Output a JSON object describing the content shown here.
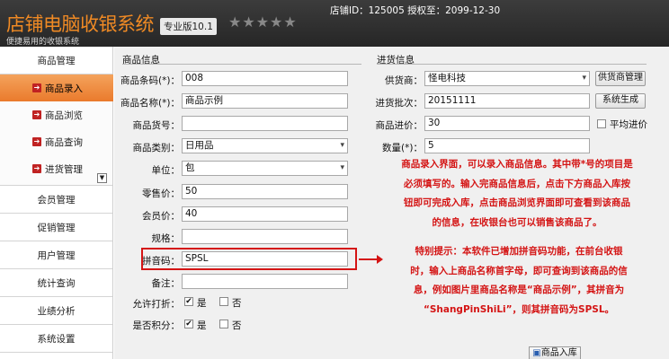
{
  "header": {
    "title": "店铺电脑收银系统",
    "subtitle": "便捷易用的收银系统",
    "edition": "专业版10.1",
    "stars": "★★★★★",
    "shop_info": "店铺ID：125005 授权至：2099-12-30"
  },
  "sidebar": {
    "items": [
      {
        "label": "商品管理"
      },
      {
        "label": "会员管理"
      },
      {
        "label": "促销管理"
      },
      {
        "label": "用户管理"
      },
      {
        "label": "统计查询"
      },
      {
        "label": "业绩分析"
      },
      {
        "label": "系统设置"
      }
    ],
    "sub_items": [
      {
        "label": "商品录入",
        "active": true
      },
      {
        "label": "商品浏览"
      },
      {
        "label": "商品查询"
      },
      {
        "label": "进货管理"
      }
    ]
  },
  "product": {
    "section_title": "商品信息",
    "barcode": {
      "label": "商品条码(*)：",
      "value": "008"
    },
    "name": {
      "label": "商品名称(*)：",
      "value": "商品示例"
    },
    "sku": {
      "label": "商品货号：",
      "value": ""
    },
    "category": {
      "label": "商品类别：",
      "value": "日用品"
    },
    "unit": {
      "label": "单位：",
      "value": "包"
    },
    "retail_price": {
      "label": "零售价：",
      "value": "50"
    },
    "member_price": {
      "label": "会员价：",
      "value": "40"
    },
    "spec": {
      "label": "规格：",
      "value": ""
    },
    "pinyin": {
      "label": "拼音码：",
      "value": "SPSL"
    },
    "remark": {
      "label": "备注：",
      "value": ""
    },
    "allow_discount": {
      "label": "允许打折：",
      "yes": "是",
      "no": "否"
    },
    "points": {
      "label": "是否积分：",
      "yes": "是",
      "no": "否"
    }
  },
  "purchase": {
    "section_title": "进货信息",
    "supplier": {
      "label": "供货商：",
      "value": "怪电科技"
    },
    "supplier_btn": "供货商管理",
    "batch": {
      "label": "进货批次：",
      "value": "20151111"
    },
    "gen_btn": "系统生成",
    "cost": {
      "label": "商品进价：",
      "value": "30"
    },
    "avg_label": "平均进价",
    "qty": {
      "label": "数量(*)：",
      "value": "5"
    }
  },
  "notes": {
    "note1": [
      "商品录入界面，可以录入商品信息。其中带*号的项目是",
      "必须填写的。输入完商品信息后，点击下方商品入库按",
      "钮即可完成入库，点击商品浏览界面即可查看到该商品",
      "的信息，在收银台也可以销售该商品了。"
    ],
    "note2": [
      "特别提示：本软件已增加拼音码功能，在前台收银",
      "时，输入上商品名称首字母，即可查询到该商品的信",
      "息，例如图片里商品名称是“商品示例”，其拼音为",
      "“ShangPinShiLi”，则其拼音码为SPSL。"
    ]
  },
  "save_btn": "商品入库"
}
